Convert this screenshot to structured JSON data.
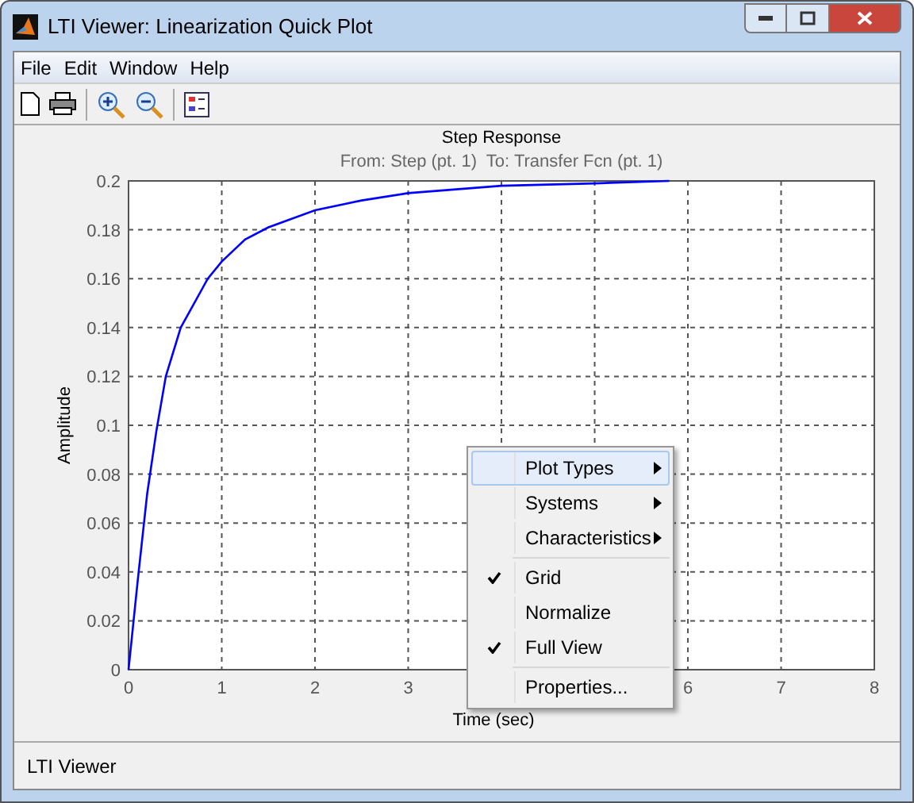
{
  "window": {
    "title": "LTI Viewer: Linearization Quick Plot"
  },
  "menu_bar": [
    "File",
    "Edit",
    "Window",
    "Help"
  ],
  "plot": {
    "title": "Step Response",
    "subtitle": "From: Step (pt. 1)  To: Transfer Fcn (pt. 1)",
    "chart_data": {
      "type": "line",
      "xlabel": "Time (sec)",
      "ylabel": "Amplitude",
      "xlim": [
        0,
        8
      ],
      "ylim": [
        0,
        0.2
      ],
      "grid": true,
      "xticks": [
        0,
        1,
        2,
        3,
        6,
        7,
        8
      ],
      "yticks": [
        {
          "value": 0,
          "label": "0"
        },
        {
          "value": 0.02,
          "label": "0.02"
        },
        {
          "value": 0.04,
          "label": "0.04"
        },
        {
          "value": 0.06,
          "label": "0.06"
        },
        {
          "value": 0.08,
          "label": "0.08"
        },
        {
          "value": 0.1,
          "label": "0.1"
        },
        {
          "value": 0.12,
          "label": "0.12"
        },
        {
          "value": 0.14,
          "label": "0.14"
        },
        {
          "value": 0.16,
          "label": "0.16"
        },
        {
          "value": 0.18,
          "label": "0.18"
        },
        {
          "value": 0.2,
          "label": "0.2"
        }
      ],
      "x": [
        0,
        0.1,
        0.2,
        0.3,
        0.4,
        0.56,
        0.85,
        1,
        1.25,
        1.5,
        2,
        2.5,
        3,
        4,
        5,
        5.8
      ],
      "series": [
        {
          "color": "#0000ff",
          "values": [
            0,
            0.037,
            0.072,
            0.098,
            0.12,
            0.14,
            0.16,
            0.167,
            0.176,
            0.181,
            0.188,
            0.192,
            0.195,
            0.198,
            0.199,
            0.2
          ]
        }
      ]
    }
  },
  "context_menu": [
    {
      "kind": "submenu",
      "label": "Plot Types",
      "selected": true
    },
    {
      "kind": "submenu",
      "label": "Systems",
      "selected": false
    },
    {
      "kind": "submenu",
      "label": "Characteristics",
      "selected": false
    },
    {
      "kind": "check",
      "label": "Grid",
      "checked": true,
      "selected": false
    },
    {
      "kind": "check",
      "label": "Normalize",
      "checked": false,
      "selected": false
    },
    {
      "kind": "check",
      "label": "Full View",
      "checked": true,
      "selected": false
    },
    {
      "kind": "action",
      "label": "Properties...",
      "selected": false
    }
  ],
  "status_bar": "LTI Viewer"
}
